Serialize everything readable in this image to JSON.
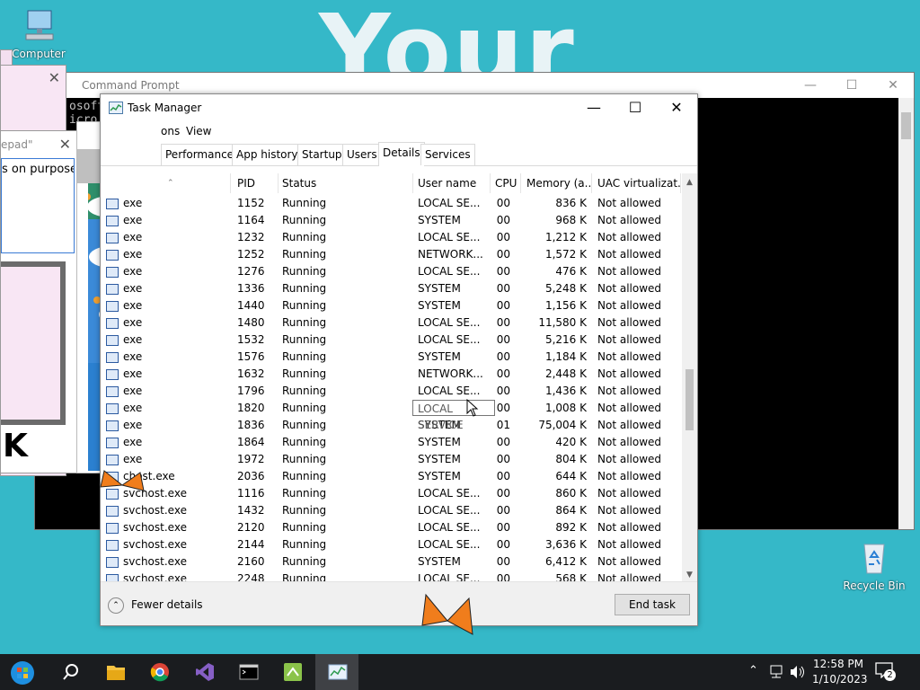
{
  "desktop": {
    "wallpaper_text": "Your",
    "icons": [
      {
        "name": "computer",
        "label": "Computer"
      },
      {
        "name": "recycle-bin",
        "label": "Recycle Bin"
      }
    ]
  },
  "background_windows": {
    "cmd_title": "Command Prompt",
    "cmd_lines": [
      "osoft",
      "icro"
    ],
    "notepad_title": "epad\"",
    "notepad_text": "s on purpose",
    "stray_text": "K"
  },
  "task_manager": {
    "title": "Task Manager",
    "menu": [
      "ons",
      "View"
    ],
    "tabs": [
      "Performance",
      "App history",
      "Startup",
      "Users",
      "Details",
      "Services"
    ],
    "active_tab": "Details",
    "columns": [
      "PID",
      "Status",
      "User name",
      "CPU",
      "Memory (a...",
      "UAC virtualizat..."
    ],
    "rows": [
      {
        "name": "exe",
        "pid": "1152",
        "status": "Running",
        "user": "LOCAL SE...",
        "cpu": "00",
        "mem": "836 K",
        "uac": "Not allowed"
      },
      {
        "name": "exe",
        "pid": "1164",
        "status": "Running",
        "user": "SYSTEM",
        "cpu": "00",
        "mem": "968 K",
        "uac": "Not allowed"
      },
      {
        "name": "exe",
        "pid": "1232",
        "status": "Running",
        "user": "LOCAL SE...",
        "cpu": "00",
        "mem": "1,212 K",
        "uac": "Not allowed"
      },
      {
        "name": "exe",
        "pid": "1252",
        "status": "Running",
        "user": "NETWORK...",
        "cpu": "00",
        "mem": "1,572 K",
        "uac": "Not allowed"
      },
      {
        "name": "exe",
        "pid": "1276",
        "status": "Running",
        "user": "LOCAL SE...",
        "cpu": "00",
        "mem": "476 K",
        "uac": "Not allowed"
      },
      {
        "name": "exe",
        "pid": "1336",
        "status": "Running",
        "user": "SYSTEM",
        "cpu": "00",
        "mem": "5,248 K",
        "uac": "Not allowed"
      },
      {
        "name": "exe",
        "pid": "1440",
        "status": "Running",
        "user": "SYSTEM",
        "cpu": "00",
        "mem": "1,156 K",
        "uac": "Not allowed"
      },
      {
        "name": "exe",
        "pid": "1480",
        "status": "Running",
        "user": "LOCAL SE...",
        "cpu": "00",
        "mem": "11,580 K",
        "uac": "Not allowed"
      },
      {
        "name": "exe",
        "pid": "1532",
        "status": "Running",
        "user": "LOCAL SE...",
        "cpu": "00",
        "mem": "5,216 K",
        "uac": "Not allowed"
      },
      {
        "name": "exe",
        "pid": "1576",
        "status": "Running",
        "user": "SYSTEM",
        "cpu": "00",
        "mem": "1,184 K",
        "uac": "Not allowed"
      },
      {
        "name": "exe",
        "pid": "1632",
        "status": "Running",
        "user": "NETWORK...",
        "cpu": "00",
        "mem": "2,448 K",
        "uac": "Not allowed"
      },
      {
        "name": "exe",
        "pid": "1796",
        "status": "Running",
        "user": "LOCAL SE...",
        "cpu": "00",
        "mem": "1,436 K",
        "uac": "Not allowed"
      },
      {
        "name": "exe",
        "pid": "1820",
        "status": "Running",
        "user": "LOCAL SE...",
        "cpu": "00",
        "mem": "1,008 K",
        "uac": "Not allowed"
      },
      {
        "name": "exe",
        "pid": "1836",
        "status": "Running",
        "user": "SYSTEM",
        "cpu": "01",
        "mem": "75,004 K",
        "uac": "Not allowed"
      },
      {
        "name": "exe",
        "pid": "1864",
        "status": "Running",
        "user": "SYSTEM",
        "cpu": "00",
        "mem": "420 K",
        "uac": "Not allowed"
      },
      {
        "name": "exe",
        "pid": "1972",
        "status": "Running",
        "user": "SYSTEM",
        "cpu": "00",
        "mem": "804 K",
        "uac": "Not allowed"
      },
      {
        "name": "chost.exe",
        "pid": "2036",
        "status": "Running",
        "user": "SYSTEM",
        "cpu": "00",
        "mem": "644 K",
        "uac": "Not allowed"
      },
      {
        "name": "svchost.exe",
        "pid": "1116",
        "status": "Running",
        "user": "LOCAL SE...",
        "cpu": "00",
        "mem": "860 K",
        "uac": "Not allowed"
      },
      {
        "name": "svchost.exe",
        "pid": "1432",
        "status": "Running",
        "user": "LOCAL SE...",
        "cpu": "00",
        "mem": "864 K",
        "uac": "Not allowed"
      },
      {
        "name": "svchost.exe",
        "pid": "2120",
        "status": "Running",
        "user": "LOCAL SE...",
        "cpu": "00",
        "mem": "892 K",
        "uac": "Not allowed"
      },
      {
        "name": "svchost.exe",
        "pid": "2144",
        "status": "Running",
        "user": "LOCAL SE...",
        "cpu": "00",
        "mem": "3,636 K",
        "uac": "Not allowed"
      },
      {
        "name": "svchost.exe",
        "pid": "2160",
        "status": "Running",
        "user": "SYSTEM",
        "cpu": "00",
        "mem": "6,412 K",
        "uac": "Not allowed"
      },
      {
        "name": "svchost.exe",
        "pid": "2248",
        "status": "Running",
        "user": "LOCAL SE...",
        "cpu": "00",
        "mem": "568 K",
        "uac": "Not allowed"
      }
    ],
    "tooltip": "LOCAL SERVICE",
    "fewer_details": "Fewer details",
    "end_task": "End task"
  },
  "taskbar": {
    "items": [
      "start",
      "search",
      "file-explorer",
      "chrome",
      "visual-studio",
      "command-prompt",
      "app",
      "task-manager"
    ],
    "time": "12:58 PM",
    "date": "1/10/2023",
    "notifications": "2"
  }
}
